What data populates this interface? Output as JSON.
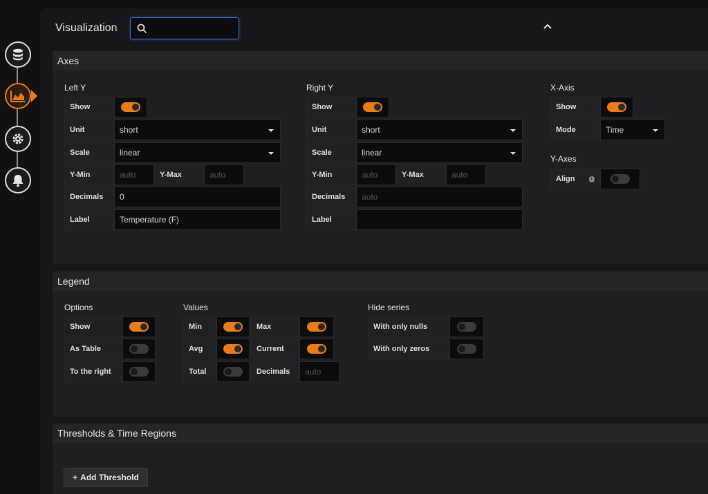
{
  "header": {
    "title": "Visualization",
    "search_placeholder": ""
  },
  "sidebar": {
    "items": [
      "database-icon",
      "chart-area-icon",
      "gear-icon",
      "bell-icon"
    ],
    "accent": "#eb7b18"
  },
  "axes": {
    "title": "Axes",
    "left_y": {
      "title": "Left Y",
      "show_label": "Show",
      "show": true,
      "unit_label": "Unit",
      "unit": "short",
      "scale_label": "Scale",
      "scale": "linear",
      "ymin_label": "Y-Min",
      "ymin_placeholder": "auto",
      "ymax_label": "Y-Max",
      "ymax_placeholder": "auto",
      "decimals_label": "Decimals",
      "decimals": "0",
      "label_label": "Label",
      "label": "Temperature (F)"
    },
    "right_y": {
      "title": "Right Y",
      "show_label": "Show",
      "show": true,
      "unit_label": "Unit",
      "unit": "short",
      "scale_label": "Scale",
      "scale": "linear",
      "ymin_label": "Y-Min",
      "ymin_placeholder": "auto",
      "ymax_label": "Y-Max",
      "ymax_placeholder": "auto",
      "decimals_label": "Decimals",
      "decimals_placeholder": "auto",
      "label_label": "Label",
      "label": ""
    },
    "x_axis": {
      "title": "X-Axis",
      "show_label": "Show",
      "show": true,
      "mode_label": "Mode",
      "mode": "Time"
    },
    "y_axes": {
      "title": "Y-Axes",
      "align_label": "Align",
      "align": false
    }
  },
  "legend": {
    "title": "Legend",
    "options": {
      "title": "Options",
      "show_label": "Show",
      "as_table_label": "As Table",
      "to_right_label": "To the right"
    },
    "values": {
      "title": "Values",
      "min_label": "Min",
      "max_label": "Max",
      "avg_label": "Avg",
      "current_label": "Current",
      "total_label": "Total",
      "decimals_label": "Decimals",
      "decimals_placeholder": "auto"
    },
    "hide_series": {
      "title": "Hide series",
      "nulls_label": "With only nulls",
      "zeros_label": "With only zeros"
    }
  },
  "thresholds": {
    "title": "Thresholds & Time Regions",
    "add_label": "Add Threshold",
    "add_icon": "+"
  }
}
